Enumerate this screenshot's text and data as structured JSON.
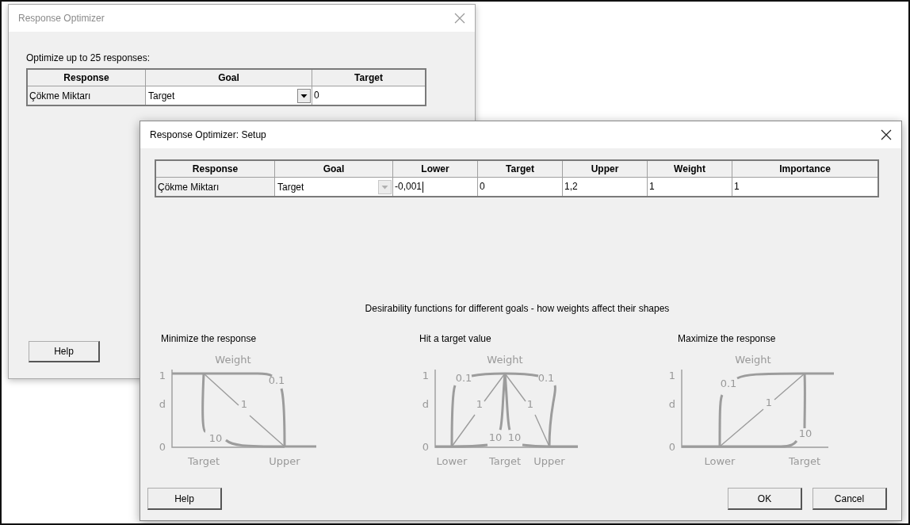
{
  "back_window": {
    "title": "Response Optimizer",
    "active": false,
    "prompt": "Optimize up to 25 responses:",
    "table": {
      "columns": [
        "Response",
        "Goal",
        "Target"
      ],
      "rows": [
        {
          "cells": [
            {
              "kind": "text",
              "text": "Çökme Miktarı"
            },
            {
              "kind": "dropdown",
              "text": "Target",
              "disabled": false
            },
            {
              "kind": "input",
              "text": "0",
              "focused": false
            }
          ]
        }
      ]
    },
    "help_button": "Help"
  },
  "front_window": {
    "title": "Response Optimizer: Setup",
    "active": true,
    "table": {
      "columns": [
        "Response",
        "Goal",
        "Lower",
        "Target",
        "Upper",
        "Weight",
        "Importance"
      ],
      "rows": [
        {
          "cells": [
            {
              "kind": "text",
              "text": "Çökme Miktarı"
            },
            {
              "kind": "dropdown",
              "text": "Target",
              "disabled": true
            },
            {
              "kind": "input",
              "text": "-0,001",
              "focused": true
            },
            {
              "kind": "input",
              "text": "0",
              "focused": false
            },
            {
              "kind": "input",
              "text": "1,2",
              "focused": false
            },
            {
              "kind": "input",
              "text": "1",
              "focused": false
            },
            {
              "kind": "input",
              "text": "1",
              "focused": false
            }
          ]
        }
      ]
    },
    "description": "Desirability functions for different goals - how weights affect their shapes",
    "diagrams": [
      {
        "kind": "minimize",
        "title": "Minimize the response",
        "weight_label": "Weight",
        "y_labels": [
          "1",
          "d",
          "0"
        ],
        "x_labels": [
          "Target",
          "Upper"
        ],
        "curve_labels": [
          "0.1",
          "1",
          "10"
        ]
      },
      {
        "kind": "target",
        "title": "Hit a target value",
        "weight_label": "Weight",
        "y_labels": [
          "1",
          "d",
          "0"
        ],
        "x_labels": [
          "Lower",
          "Target",
          "Upper"
        ],
        "curve_labels": [
          "0.1",
          "1",
          "10",
          "10",
          "1",
          "0.1"
        ]
      },
      {
        "kind": "maximize",
        "title": "Maximize the response",
        "weight_label": "Weight",
        "y_labels": [
          "1",
          "d",
          "0"
        ],
        "x_labels": [
          "Lower",
          "Target"
        ],
        "curve_labels": [
          "0.1",
          "1",
          "10"
        ]
      }
    ],
    "help_button": "Help",
    "buttons": [
      "OK",
      "Cancel"
    ]
  }
}
